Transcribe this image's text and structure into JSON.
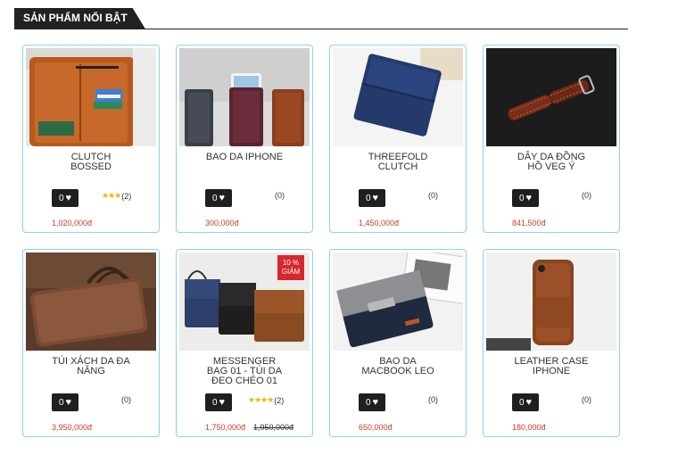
{
  "section": {
    "title": "SẢN PHẨM NỔI BẬT"
  },
  "products": [
    {
      "name": "CLUTCH\nBOSSED",
      "likes": "0",
      "stars": "★★★",
      "rating_count": "(2)",
      "price": "1,020,000đ",
      "image_icon": "clutch-bossed-photo"
    },
    {
      "name": "BAO DA IPHONE",
      "likes": "0",
      "rating_count": "(0)",
      "price": "300,000đ",
      "image_icon": "iphone-sleeve-photo"
    },
    {
      "name": "THREEFOLD\nCLUTCH",
      "likes": "0",
      "rating_count": "(0)",
      "price": "1,450,000đ",
      "image_icon": "threefold-clutch-photo"
    },
    {
      "name": "DÂY DA ĐỒNG\nHỒ VEG Ý",
      "likes": "0",
      "rating_count": "(0)",
      "price": "841,500đ",
      "image_icon": "watch-strap-photo"
    },
    {
      "name": "TÚI XÁCH DA ĐA\nNĂNG",
      "likes": "0",
      "rating_count": "(0)",
      "price": "3,950,000đ",
      "image_icon": "leather-briefcase-photo"
    },
    {
      "name": "MESSENGER\nBAG 01 - TÚI DA\nĐEO CHÉO 01",
      "likes": "0",
      "stars": "★★★★",
      "rating_count": "(2)",
      "price": "1,750,000đ",
      "old_price": "1,950,000đ",
      "badge": "10 %\nGIẢM",
      "image_icon": "messenger-bags-photo"
    },
    {
      "name": "BAO DA\nMACBOOK LEO",
      "likes": "0",
      "rating_count": "(0)",
      "price": "650,000đ",
      "image_icon": "macbook-sleeve-photo"
    },
    {
      "name": "LEATHER CASE\nIPHONE",
      "likes": "0",
      "rating_count": "(0)",
      "price": "180,000đ",
      "image_icon": "leather-iphone-case-photo"
    }
  ]
}
